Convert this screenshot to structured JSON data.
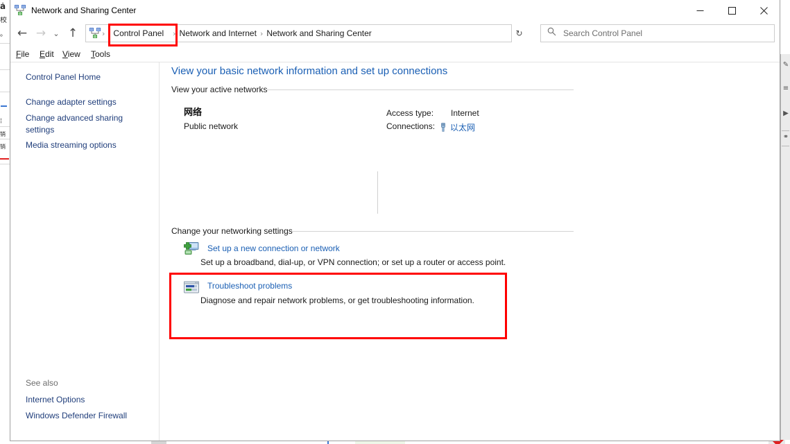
{
  "window": {
    "title": "Network and Sharing Center",
    "icon": "network-sharing-icon",
    "minimize_label": "Minimize",
    "maximize_label": "Maximize",
    "close_label": "Close"
  },
  "navigation": {
    "back_glyph": "←",
    "forward_glyph": "→",
    "recent_glyph": "⌄",
    "up_glyph": "↑",
    "refresh_glyph": "↻",
    "dropdown_glyph": "⌄",
    "separator_glyph": "›",
    "breadcrumbs": [
      {
        "label": "Control Panel",
        "highlighted": true
      },
      {
        "label": "Network and Internet",
        "highlighted": false
      },
      {
        "label": "Network and Sharing Center",
        "highlighted": false
      }
    ]
  },
  "search": {
    "placeholder": "Search Control Panel",
    "value": "",
    "icon": "search-icon"
  },
  "menubar": {
    "items": [
      {
        "accel": "F",
        "rest": "ile"
      },
      {
        "accel": "E",
        "rest": "dit"
      },
      {
        "accel": "V",
        "rest": "iew"
      },
      {
        "accel": "T",
        "rest": "ools"
      }
    ]
  },
  "sidebar": {
    "links": [
      "Control Panel Home",
      "Change adapter settings",
      "Change advanced sharing settings",
      "Media streaming options"
    ],
    "see_also_label": "See also",
    "see_also_links": [
      "Internet Options",
      "Windows Defender Firewall"
    ]
  },
  "content": {
    "page_title": "View your basic network information and set up connections",
    "sections": [
      {
        "heading": "View your active networks"
      },
      {
        "heading": "Change your networking settings"
      }
    ],
    "active_network": {
      "name": "网络",
      "network_type": "Public network",
      "access_type_label": "Access type:",
      "access_type_value": "Internet",
      "connections_label": "Connections:",
      "connections_value": "以太网",
      "connection_icon": "ethernet-adapter-icon"
    },
    "tasks": [
      {
        "link": "Set up a new connection or network",
        "description": "Set up a broadband, dial-up, or VPN connection; or set up a router or access point.",
        "icon": "new-connection-icon"
      },
      {
        "link": "Troubleshoot problems",
        "description": "Diagnose and repair network problems, or get troubleshooting information.",
        "icon": "troubleshoot-icon"
      }
    ]
  },
  "annotations": {
    "color": "#ff0000",
    "highlights": [
      {
        "target": "breadcrumb-control-panel"
      },
      {
        "target": "troubleshoot-problems-task"
      }
    ]
  },
  "background": {
    "left_strip_glyphs": [
      "å",
      "校",
      "。",
      "¦",
      "流",
      "销",
      "销"
    ],
    "right_strip_icons": [
      "pen-icon",
      "list-icon",
      "cursor-icon",
      "key-icon"
    ]
  }
}
